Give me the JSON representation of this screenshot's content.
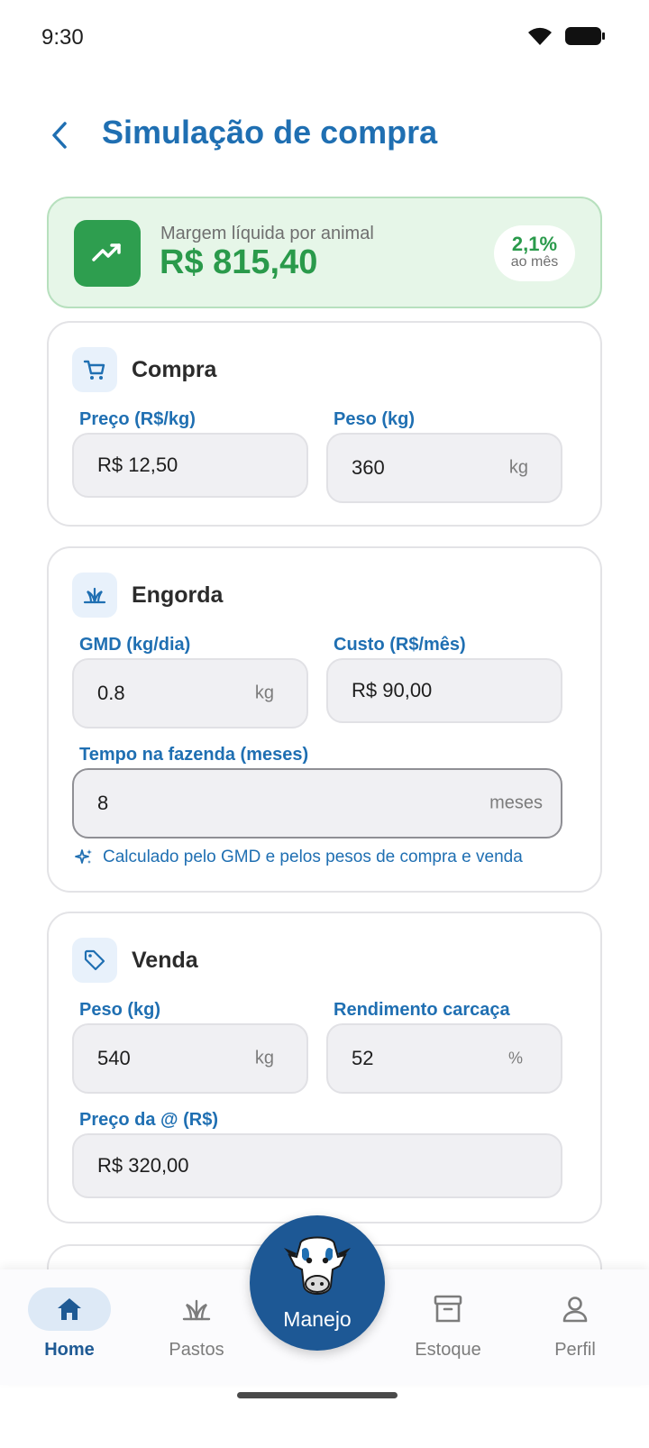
{
  "status": {
    "time": "9:30"
  },
  "header": {
    "title": "Simulação de compra"
  },
  "summary": {
    "label": "Margem líquida por animal",
    "value": "R$ 815,40",
    "badge_value": "2,1%",
    "badge_sub": "ao mês"
  },
  "compra": {
    "title": "Compra",
    "price_label": "Preço (R$/kg)",
    "price_value": "R$ 12,50",
    "weight_label": "Peso (kg)",
    "weight_value": "360",
    "weight_suffix": "kg"
  },
  "engorda": {
    "title": "Engorda",
    "gmd_label": "GMD (kg/dia)",
    "gmd_value": "0.8",
    "gmd_suffix": "kg",
    "cost_label": "Custo (R$/mês)",
    "cost_value": "R$ 90,00",
    "time_label": "Tempo na fazenda (meses)",
    "time_value": "8",
    "time_suffix": "meses",
    "hint": "Calculado pelo GMD e pelos pesos de compra e venda"
  },
  "venda": {
    "title": "Venda",
    "weight_label": "Peso (kg)",
    "weight_value": "540",
    "weight_suffix": "kg",
    "yield_label": "Rendimento carcaça",
    "yield_value": "52",
    "yield_suffix": "%",
    "price_label": "Preço da @ (R$)",
    "price_value": "R$ 320,00"
  },
  "nav": {
    "home": "Home",
    "pastos": "Pastos",
    "manejo": "Manejo",
    "estoque": "Estoque",
    "perfil": "Perfil"
  },
  "colors": {
    "primary": "#1f6fb2",
    "success": "#2a9a4b",
    "fab": "#1d5895"
  }
}
